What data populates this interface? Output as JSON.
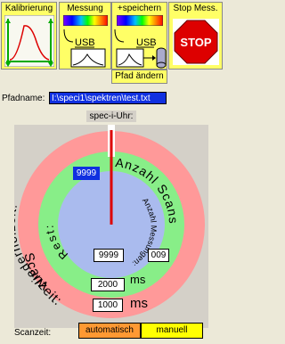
{
  "toolbar": {
    "kalibrierung": "Kalibrierung",
    "messung": "Messung",
    "speichern": "+speichern",
    "stop_title": "Stop Mess.",
    "stop_sign": "STOP",
    "usb": "USB",
    "pfad_aendern": "Pfad ändern"
  },
  "pfad": {
    "label": "Pfadname:",
    "value": "I:\\speci1\\spektren\\test.txt"
  },
  "uhr": {
    "label": "spec-i-Uhr:",
    "anzahl_scans": "Anzahl Scans:",
    "anzahl_messungen": "Anzahl Messungen:",
    "rest": "Rest:",
    "wiederholzeit": "Wiederholzeit:",
    "scanzeit_arc": "Scanzeit:",
    "rest_value": "9999",
    "messungen_value": "9999",
    "scans_value": "009",
    "wiederholzeit_value": "2000",
    "scanzeit_value": "1000",
    "unit_ms_1": "ms",
    "unit_ms_2": "ms"
  },
  "scanzeit": {
    "label": "Scanzeit:",
    "auto": "automatisch",
    "manuell": "manuell"
  },
  "colors": {
    "outer_ring": "#ff9999",
    "middle_ring": "#88ee88",
    "inner_disc": "#aabbee",
    "needle": "#dd0000",
    "highlight": "#1030e0"
  }
}
